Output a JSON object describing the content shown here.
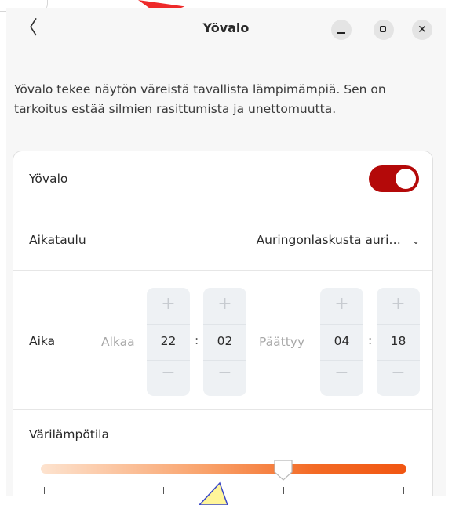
{
  "window": {
    "title": "Yövalo",
    "back_glyph": "〈",
    "controls": {
      "minimize_icon": "minimize-icon",
      "maximize_icon": "maximize-icon",
      "close_glyph": "✕"
    }
  },
  "description": "Yövalo tekee näytön väreistä tavallista lämpimämpiä. Sen on tarkoitus estää silmien rasittumista ja unettomuutta.",
  "night_light": {
    "label": "Yövalo",
    "enabled": true,
    "accent_color": "#b40909"
  },
  "schedule": {
    "label": "Aikataulu",
    "selected": "Auringonlaskusta auri…",
    "chevron_glyph": "⌄"
  },
  "time": {
    "label": "Aika",
    "start_label": "Alkaa",
    "end_label": "Päättyy",
    "start_hours": "22",
    "start_minutes": "02",
    "end_hours": "04",
    "end_minutes": "18",
    "separator": ":",
    "plus_glyph": "+",
    "minus_glyph": "−"
  },
  "color_temperature": {
    "label": "Värilämpötila",
    "level": 0.67
  }
}
